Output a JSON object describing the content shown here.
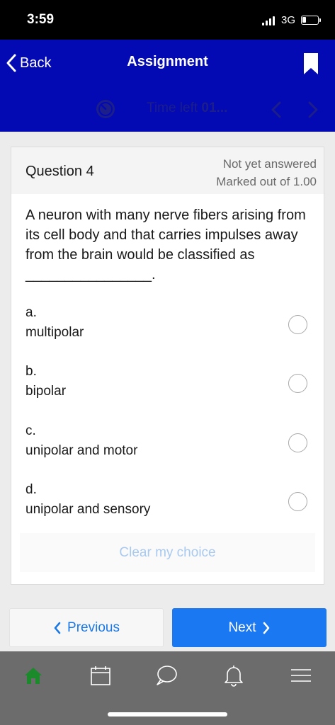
{
  "status_bar": {
    "time": "3:59",
    "network": "3G",
    "battery_level": 0.25
  },
  "header": {
    "back_label": "Back",
    "title": "Assignment",
    "time_left_prefix": "Time left ",
    "time_left_value": "01..."
  },
  "question": {
    "title": "Question 4",
    "status": "Not yet answered",
    "marks": "Marked out of 1.00",
    "text": "A neuron with many nerve fibers arising from its cell body and that carries impulses away from the brain would be classified as ________________.",
    "options": [
      {
        "letter": "a.",
        "text": "multipolar",
        "selected": false
      },
      {
        "letter": "b.",
        "text": "bipolar",
        "selected": false
      },
      {
        "letter": "c.",
        "text": "unipolar and motor",
        "selected": false
      },
      {
        "letter": "d.",
        "text": "unipolar and sensory",
        "selected": false
      }
    ],
    "clear_label": "Clear my choice"
  },
  "navigation": {
    "previous_label": "Previous",
    "next_label": "Next"
  },
  "tab_bar": {
    "items": [
      {
        "icon": "home-icon",
        "active": true
      },
      {
        "icon": "calendar-icon",
        "active": false
      },
      {
        "icon": "chat-icon",
        "active": false
      },
      {
        "icon": "bell-icon",
        "active": false
      },
      {
        "icon": "menu-icon",
        "active": false
      }
    ]
  },
  "colors": {
    "header_bg": "#0309b3",
    "accent_blue": "#1a78f2",
    "active_tab": "#1a8a2a",
    "tab_bar_bg": "#6c6c6c"
  }
}
